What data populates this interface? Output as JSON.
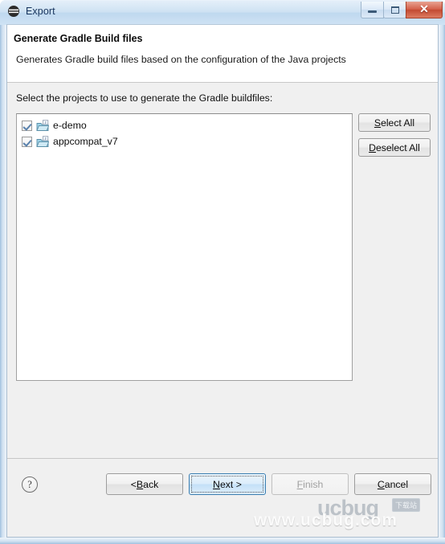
{
  "window": {
    "title": "Export",
    "app_icon": "eclipse-export-icon",
    "controls": {
      "minimize": "minimize-icon",
      "maximize": "maximize-icon",
      "close": "✕"
    }
  },
  "header": {
    "title": "Generate Gradle Build files",
    "description": "Generates Gradle build files based on the configuration of the Java projects"
  },
  "main": {
    "instruction_before": "Select the projects to use to ",
    "instruction_mnemonic": "g",
    "instruction_after": "enerate the Gradle buildfiles:",
    "instruction_full": "Select the projects to use to generate the Gradle buildfiles:",
    "projects": [
      {
        "label": "e-demo",
        "checked": true,
        "icon": "java-project-icon"
      },
      {
        "label": "appcompat_v7",
        "checked": true,
        "icon": "java-project-icon"
      }
    ],
    "side_buttons": [
      {
        "mnemonic": "S",
        "rest": "elect All",
        "label": "Select All",
        "name": "select-all-button"
      },
      {
        "mnemonic": "D",
        "rest": "eselect All",
        "label": "Deselect All",
        "name": "deselect-all-button"
      }
    ]
  },
  "footer": {
    "help_glyph": "?",
    "buttons": [
      {
        "prefix": "< ",
        "mnemonic": "B",
        "rest": "ack",
        "label": "< Back",
        "state": "enabled",
        "name": "back-button"
      },
      {
        "prefix": "",
        "mnemonic": "N",
        "rest": "ext >",
        "label": "Next >",
        "state": "focused",
        "name": "next-button"
      },
      {
        "prefix": "",
        "mnemonic": "F",
        "rest": "inish",
        "label": "Finish",
        "state": "disabled",
        "name": "finish-button"
      },
      {
        "prefix": "",
        "mnemonic": "C",
        "rest": "ancel",
        "label": "Cancel",
        "state": "enabled",
        "name": "cancel-button"
      }
    ]
  },
  "watermark": {
    "url": "www.ucbug.com",
    "logo": "ucbug",
    "badge": "下载站"
  },
  "colors": {
    "titlebar_accent": "#cfe2f3",
    "close_button": "#c24a32",
    "focus_border": "#3c7fb1",
    "dialog_bg": "#f0f0f0",
    "list_bg": "#ffffff"
  }
}
